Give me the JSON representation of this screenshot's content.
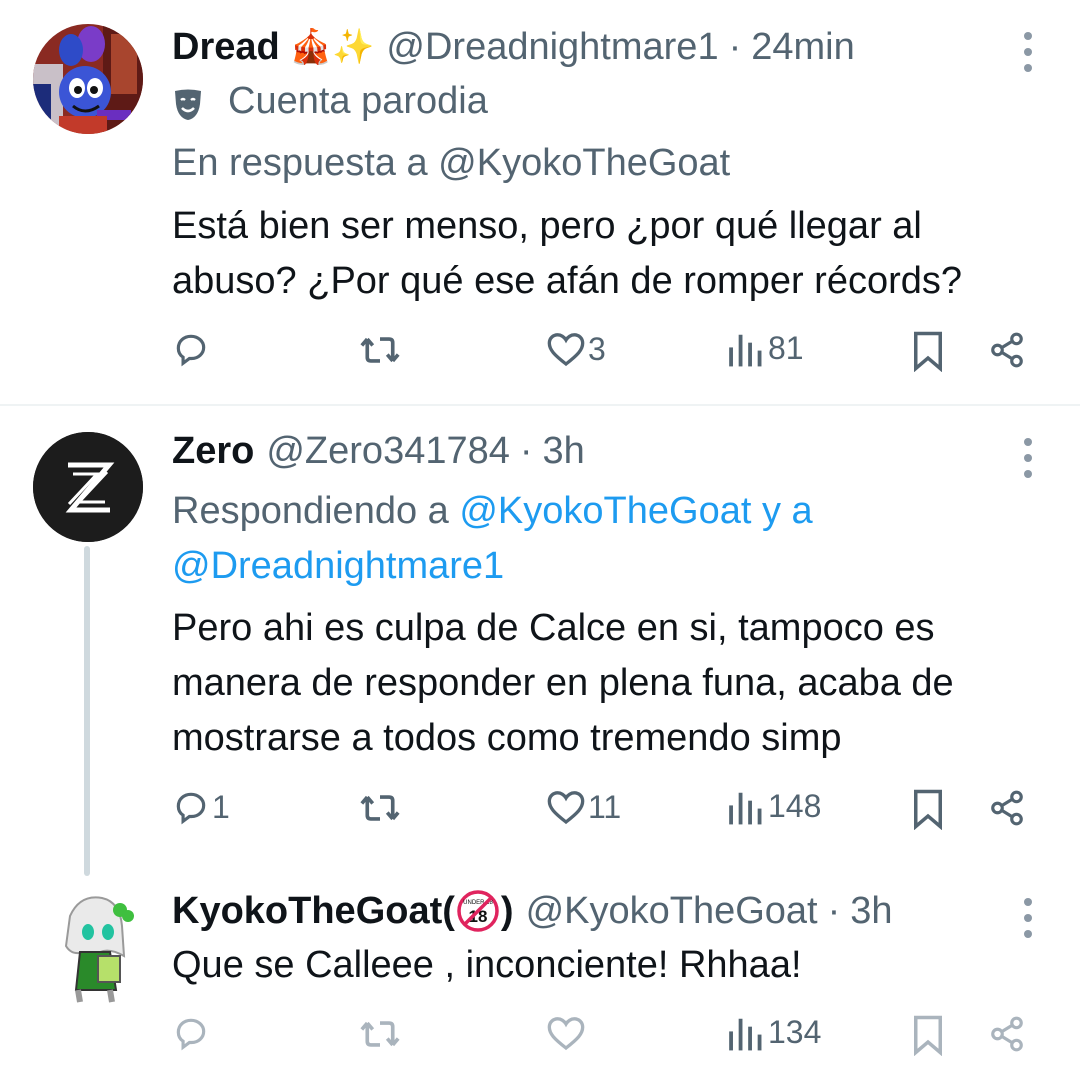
{
  "tweets": [
    {
      "name": "Dread",
      "name_emoji": "🎪✨",
      "handle": "@Dreadnightmare1",
      "sep": "·",
      "time": "24min",
      "badge": "Cuenta parodia",
      "badge_icon": "theater-masks-icon",
      "reply_to": "En respuesta a @KyokoTheGoat",
      "text_lines": [
        "Está bien ser menso, pero ¿por qué llegar al",
        "abuso? ¿Por qué ese afán de romper récords?"
      ],
      "replies": "",
      "retweets": "",
      "likes": "3",
      "views": "81"
    },
    {
      "name": "Zero",
      "handle": "@Zero341784",
      "sep": "·",
      "time": "3h",
      "reply_prefix": "Respondiendo a ",
      "reply_mention1": "@KyokoTheGoat y a",
      "reply_mention2": "@Dreadnightmare1",
      "text_lines": [
        "Pero ahi es culpa de Calce en si, tampoco es",
        "manera de responder en plena funa, acaba de",
        "mostrarse a todos como tremendo simp"
      ],
      "replies": "1",
      "retweets": "",
      "likes": "11",
      "views": "148"
    },
    {
      "name": "KyokoTheGoat(",
      "name_end": ")",
      "name_badge_text": "UNDER 18",
      "name_badge_num": "18",
      "handle": "@KyokoTheGoat",
      "sep": "·",
      "time": "3h",
      "text_lines": [
        "Que se Calleee , inconciente! Rhhaa!"
      ],
      "replies": "",
      "retweets": "",
      "likes": "",
      "views": "134"
    }
  ],
  "colors": {
    "text": "#0f1419",
    "secondary": "#536471",
    "link": "#1d9bf0",
    "divider": "#eff3f4"
  }
}
